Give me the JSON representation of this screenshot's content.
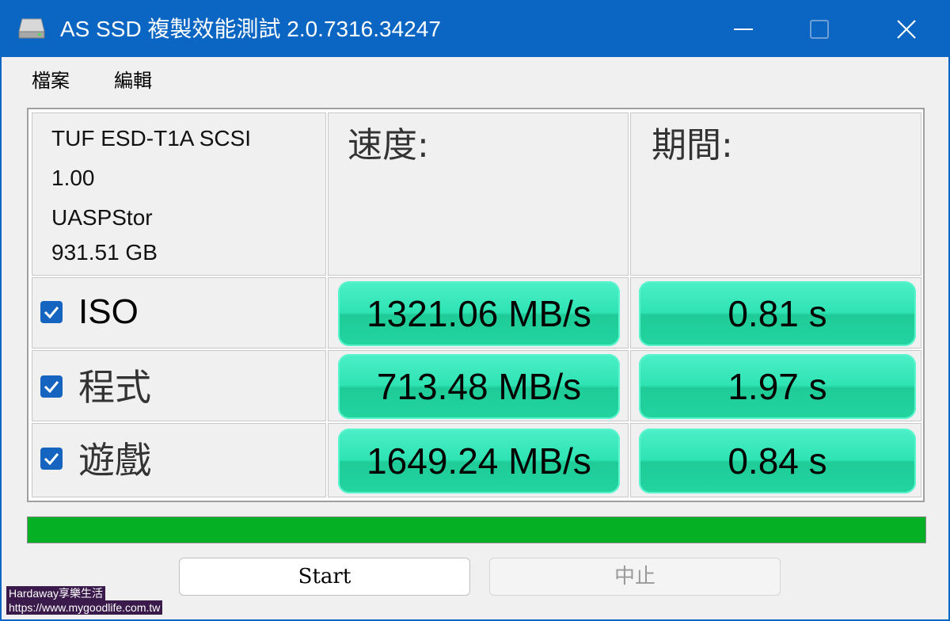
{
  "window": {
    "title": "AS SSD 複製效能測試 2.0.7316.34247"
  },
  "menu": {
    "file": "檔案",
    "edit": "編輯"
  },
  "drive": {
    "model": "TUF ESD-T1A SCSI",
    "firmware": "1.00",
    "driver": "UASPStor",
    "capacity": "931.51 GB"
  },
  "columns": {
    "speed": "速度:",
    "duration": "期間:"
  },
  "tests": [
    {
      "name": "ISO",
      "checked": true,
      "speed": "1321.06 MB/s",
      "duration": "0.81 s"
    },
    {
      "name": "程式",
      "checked": true,
      "speed": "713.48 MB/s",
      "duration": "1.97 s"
    },
    {
      "name": "遊戲",
      "checked": true,
      "speed": "1649.24 MB/s",
      "duration": "0.84 s"
    }
  ],
  "progress": {
    "percent": 100
  },
  "buttons": {
    "start": "Start",
    "stop": "中止"
  },
  "watermark": {
    "line1": "Hardaway享樂生活",
    "line2": "https://www.mygoodlife.com.tw"
  },
  "colors": {
    "titlebar": "#0a66c2",
    "result_green": "#2fe3b3",
    "progress_green": "#06b025",
    "checkbox_blue": "#1565c0"
  },
  "icons": {
    "app": "drive-icon",
    "minimize": "minimize-icon",
    "maximize": "maximize-icon",
    "close": "close-icon",
    "check": "checkmark-icon"
  }
}
